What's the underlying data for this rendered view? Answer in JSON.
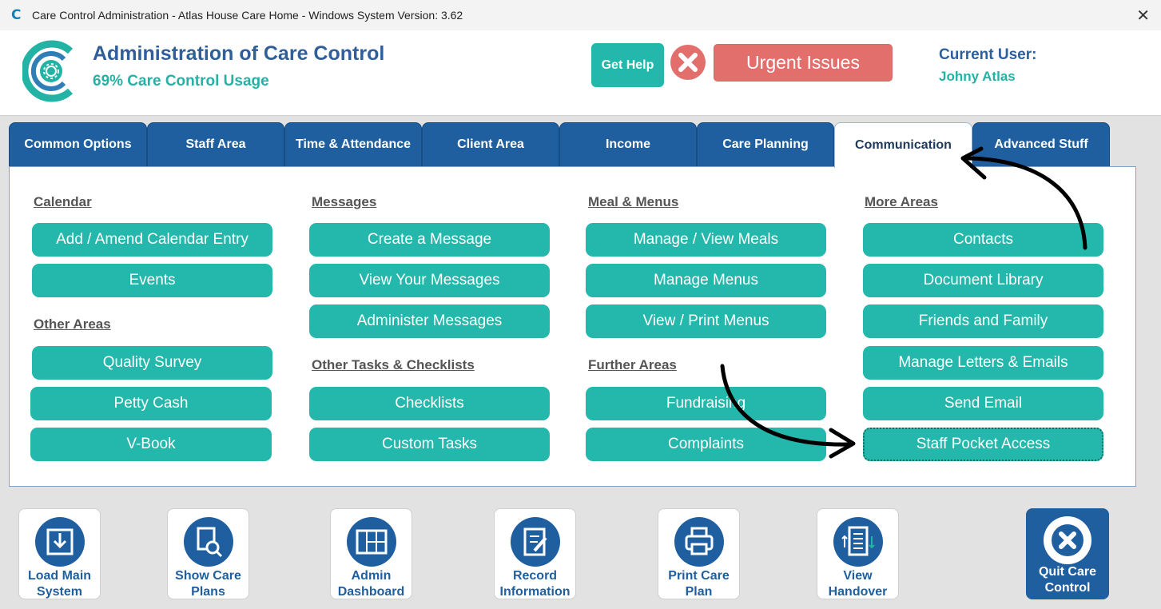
{
  "window": {
    "title": "Care Control Administration - Atlas House Care Home - Windows System Version: 3.62",
    "app_icon": "C",
    "close_glyph": "✕"
  },
  "header": {
    "title": "Administration of Care Control",
    "usage": "69% Care Control Usage",
    "help_label": "Get Help",
    "urgent_label": "Urgent Issues",
    "current_user_label": "Current User:",
    "current_user_name": "Johny Atlas"
  },
  "tabs": [
    {
      "label": "Common Options"
    },
    {
      "label": "Staff Area"
    },
    {
      "label": "Time & Attendance"
    },
    {
      "label": "Client Area"
    },
    {
      "label": "Income"
    },
    {
      "label": "Care Planning"
    },
    {
      "label": "Communication"
    },
    {
      "label": "Advanced Stuff"
    }
  ],
  "active_tab": "Communication",
  "sections": {
    "calendar": {
      "heading": "Calendar",
      "items": [
        "Add / Amend Calendar Entry",
        "Events"
      ]
    },
    "other_areas": {
      "heading": "Other Areas",
      "items": [
        "Quality Survey",
        "Petty Cash",
        "V-Book"
      ]
    },
    "messages": {
      "heading": "Messages",
      "items": [
        "Create a Message",
        "View Your Messages",
        "Administer Messages"
      ]
    },
    "other_tasks": {
      "heading": "Other Tasks & Checklists",
      "items": [
        "Checklists",
        "Custom Tasks"
      ]
    },
    "meal_menus": {
      "heading": "Meal & Menus",
      "items": [
        "Manage / View Meals",
        "Manage Menus",
        "View / Print Menus"
      ]
    },
    "further_areas": {
      "heading": "Further Areas",
      "items": [
        "Fundraising",
        "Complaints"
      ]
    },
    "more_areas": {
      "heading": "More Areas",
      "items": [
        "Contacts",
        "Document Library",
        "Friends and Family",
        "Manage Letters & Emails",
        "Send Email",
        "Staff Pocket Access"
      ]
    }
  },
  "bottom_bar": [
    {
      "label": "Load Main System",
      "icon": "download-box-icon"
    },
    {
      "label": "Show Care Plans",
      "icon": "search-documents-icon"
    },
    {
      "label": "Admin Dashboard",
      "icon": "dashboard-icon"
    },
    {
      "label": "Record Information",
      "icon": "edit-document-icon"
    },
    {
      "label": "Print Care Plan",
      "icon": "printer-icon"
    },
    {
      "label": "View Handover",
      "icon": "handover-list-icon"
    }
  ],
  "quit_label": "Quit Care Control",
  "colors": {
    "teal": "#23b8ab",
    "navy": "#1f5f9f",
    "urgent": "#e26f6c",
    "title_blue": "#2f5f9a"
  }
}
